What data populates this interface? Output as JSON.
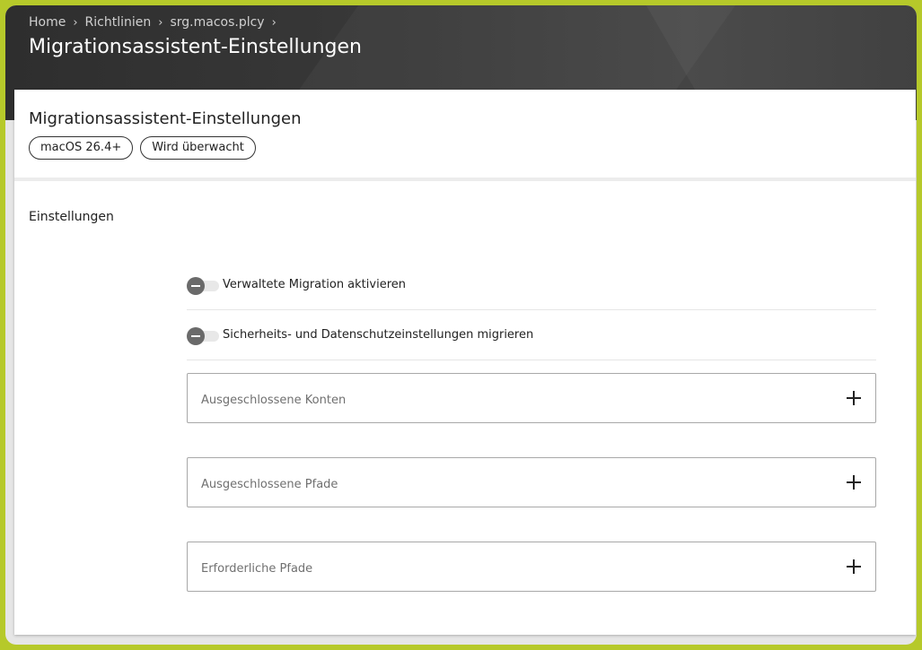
{
  "breadcrumb": {
    "items": [
      "Home",
      "Richtlinien",
      "srg.macos.plcy"
    ]
  },
  "header": {
    "title": "Migrationsassistent-Einstellungen"
  },
  "card": {
    "title": "Migrationsassistent-Einstellungen",
    "badges": [
      "macOS 26.4+",
      "Wird überwacht"
    ]
  },
  "settings": {
    "section_label": "Einstellungen",
    "toggles": [
      {
        "label": "Verwaltete Migration aktivieren",
        "enabled": false
      },
      {
        "label": "Sicherheits- und Datenschutzeinstellungen migrieren",
        "enabled": false
      }
    ],
    "lists": [
      {
        "label": "Ausgeschlossene Konten",
        "icon": "plus-icon"
      },
      {
        "label": "Ausgeschlossene Pfade",
        "icon": "plus-icon"
      },
      {
        "label": "Erforderliche Pfade",
        "icon": "plus-icon"
      }
    ]
  },
  "colors": {
    "frame": "#b6c92a",
    "header": "#3a3a3a",
    "toggle_knob": "#6a6a6a"
  }
}
